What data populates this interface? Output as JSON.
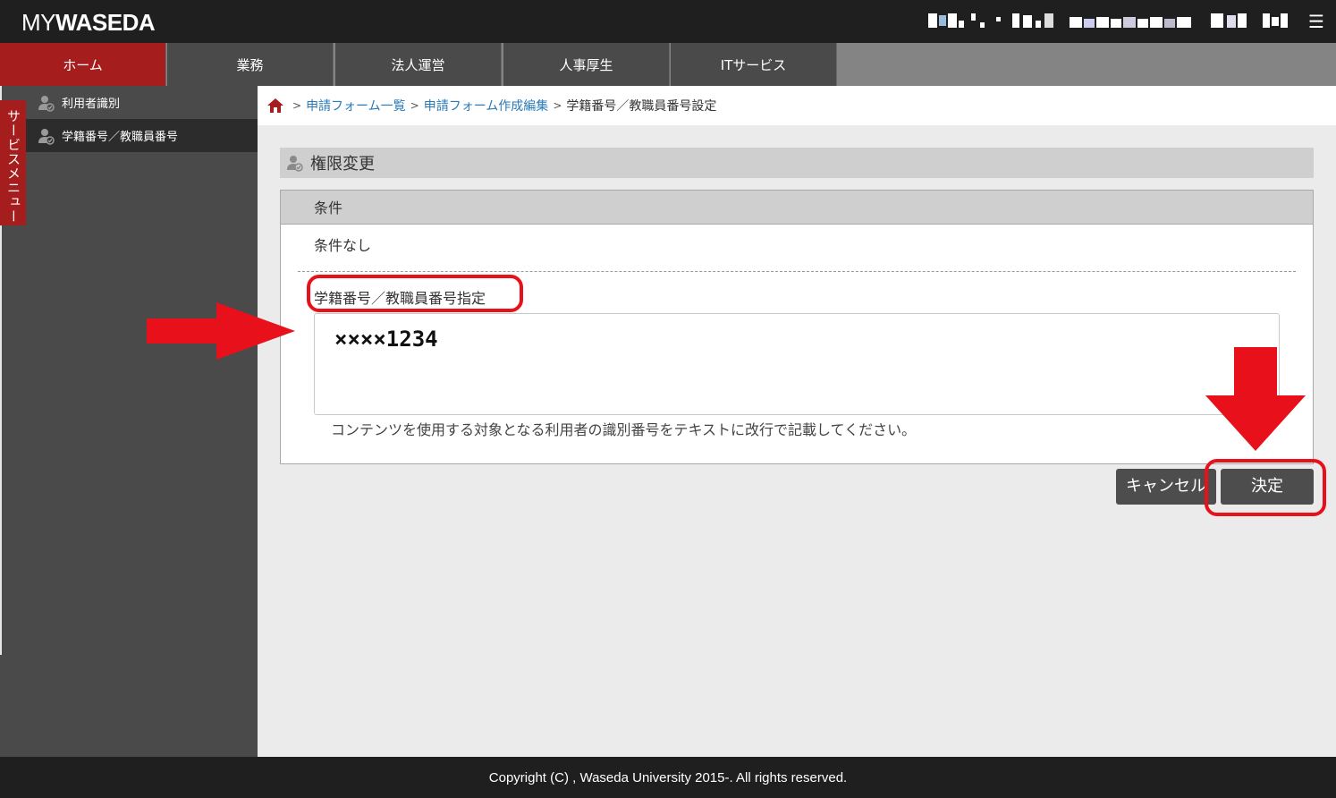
{
  "header": {
    "logo_my": "MY",
    "logo_waseda": "WASEDA",
    "menu_icon": "hamburger-icon"
  },
  "nav": {
    "tabs": [
      {
        "label": "ホーム",
        "active": true
      },
      {
        "label": "業務"
      },
      {
        "label": "法人運営"
      },
      {
        "label": "人事厚生"
      },
      {
        "label": "ITサービス"
      }
    ]
  },
  "sidebar": {
    "service_menu": "サービスメニュー",
    "items": [
      {
        "label": "利用者識別",
        "icon": "user-check-icon"
      },
      {
        "label": "学籍番号／教職員番号",
        "icon": "user-check-icon",
        "selected": true
      }
    ]
  },
  "breadcrumb": {
    "home_icon": "home-icon",
    "sep": ">",
    "link1": "申請フォーム一覧",
    "link2": "申請フォーム作成編集",
    "current": "学籍番号／教職員番号設定"
  },
  "section": {
    "title": "権限変更",
    "icon": "user-check-icon"
  },
  "panel": {
    "header": "条件",
    "condition_text": "条件なし",
    "field_label": "学籍番号／教職員番号指定",
    "field_value": "××××1234",
    "hint": "コンテンツを使用する対象となる利用者の識別番号をテキストに改行で記載してください。"
  },
  "buttons": {
    "cancel": "キャンセル",
    "ok": "決定"
  },
  "footer": {
    "copyright": "Copyright (C) , Waseda University 2015-. All rights reserved."
  },
  "colors": {
    "brand_red": "#a51d1d",
    "annotation_red": "#e8111b",
    "dark": "#1f1f1f",
    "link": "#2a7ab8"
  }
}
